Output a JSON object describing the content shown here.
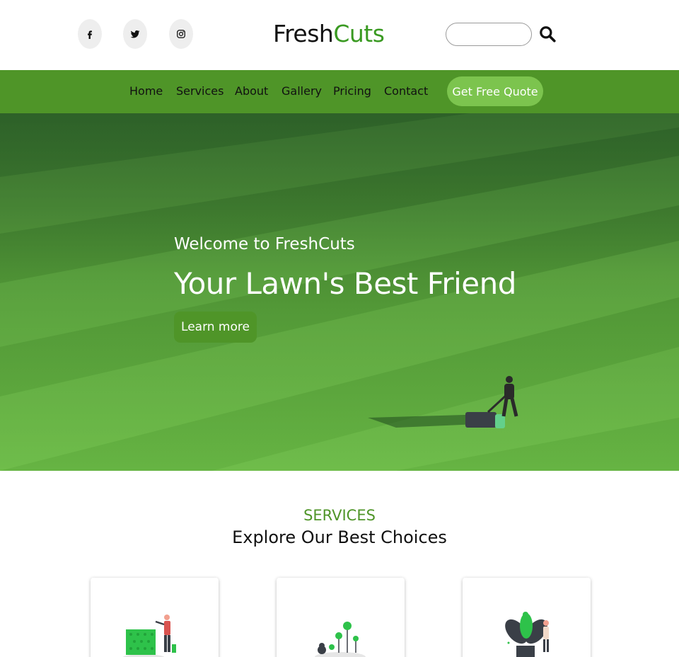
{
  "header": {
    "brand_part1": "Fresh",
    "brand_part2": "Cuts",
    "social": [
      {
        "name": "facebook",
        "icon": "facebook-icon"
      },
      {
        "name": "twitter",
        "icon": "twitter-icon"
      },
      {
        "name": "instagram",
        "icon": "instagram-icon"
      }
    ],
    "search": {
      "placeholder": "",
      "value": "",
      "icon": "search-icon"
    }
  },
  "nav": {
    "items": [
      "Home",
      "Services",
      "About",
      "Gallery",
      "Pricing",
      "Contact"
    ],
    "cta": "Get Free Quote"
  },
  "hero": {
    "welcome": "Welcome to FreshCuts",
    "title": "Your Lawn's Best Friend",
    "button": "Learn more"
  },
  "services": {
    "label": "SERVICES",
    "title": "Explore Our Best Choices"
  },
  "colors": {
    "brand_green": "#3a9a22",
    "nav_green": "#4f9528",
    "cta_green": "#7cc44e",
    "text": "#111111"
  }
}
